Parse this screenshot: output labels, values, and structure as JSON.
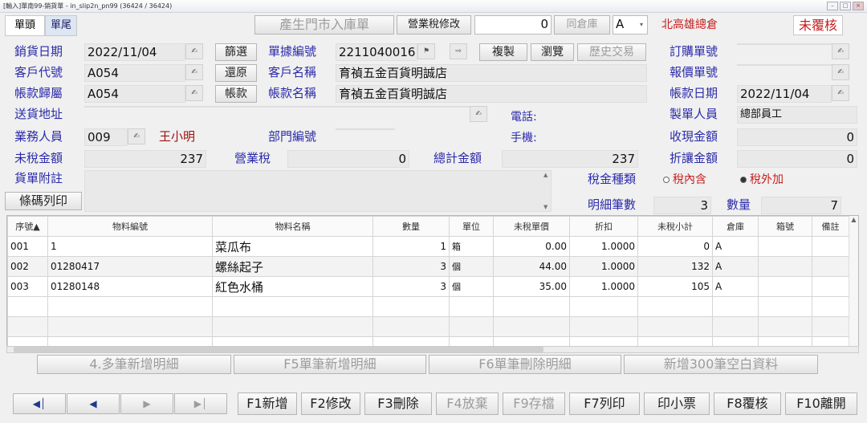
{
  "window": {
    "title": "[輸入]單南99-銷貨單 - in_slip2n_pn99   (36424 / 36424)"
  },
  "tabs": [
    "單頭",
    "單尾"
  ],
  "toolbar": {
    "import_button": "產生門市入庫單",
    "tax_edit_button": "營業稅修改",
    "counter_value": "0",
    "same_warehouse_button": "同倉庫",
    "warehouse_code": "A",
    "branch": "北高雄總倉",
    "review_status": "未覆核"
  },
  "form": {
    "sales_date": {
      "label": "銷貨日期",
      "value": "2022/11/04"
    },
    "filter_button": "篩選",
    "doc_no": {
      "label": "單據編號",
      "value": "2211040016"
    },
    "copy_button": "複製",
    "browse_button": "瀏覽",
    "history_button": "歷史交易",
    "po_no": {
      "label": "訂購單號",
      "value": ""
    },
    "customer_code": {
      "label": "客戶代號",
      "value": "A054"
    },
    "restore_button": "還原",
    "customer_name": {
      "label": "客戶名稱",
      "value": "育禎五金百貨明誠店"
    },
    "quote_no": {
      "label": "報價單號",
      "value": ""
    },
    "account_belong": {
      "label": "帳款歸屬",
      "value": "A054"
    },
    "account_button": "帳款",
    "account_name": {
      "label": "帳款名稱",
      "value": "育禎五金百貨明誠店"
    },
    "account_date": {
      "label": "帳款日期",
      "value": "2022/11/04"
    },
    "ship_address": {
      "label": "送貨地址",
      "value": ""
    },
    "phone": {
      "label": "電話:",
      "value": ""
    },
    "creator": {
      "label": "製單人員",
      "value": "總部員工"
    },
    "salesperson": {
      "label": "業務人員",
      "code": "009",
      "name": "王小明"
    },
    "department": {
      "label": "部門編號",
      "value": ""
    },
    "mobile": {
      "label": "手機:",
      "value": ""
    },
    "cash_received": {
      "label": "收現金額",
      "value": "0"
    },
    "pretax_amount": {
      "label": "未稅金額",
      "value": "237"
    },
    "sales_tax": {
      "label": "營業稅",
      "value": "0"
    },
    "total_amount": {
      "label": "總計金額",
      "value": "237"
    },
    "discount_amount": {
      "label": "折讓金額",
      "value": "0"
    },
    "remarks": {
      "label": "貨單附註",
      "value": ""
    },
    "tax_type": {
      "label": "稅金種類",
      "option_inclusive": "稅內含",
      "option_exclusive": "稅外加",
      "selected": "稅外加"
    },
    "barcode_print_button": "條碼列印",
    "detail_count": {
      "label": "明細筆數",
      "value": "3"
    },
    "quantity": {
      "label": "數量",
      "value": "7"
    }
  },
  "grid": {
    "columns": [
      "序號▲",
      "物料編號",
      "物料名稱",
      "數量",
      "單位",
      "未稅單價",
      "折扣",
      "未稅小計",
      "倉庫",
      "箱號",
      "備註"
    ],
    "rows": [
      [
        "001",
        "1",
        "菜瓜布",
        "1",
        "箱",
        "0.00",
        "1.0000",
        "0",
        "A",
        "",
        ""
      ],
      [
        "002",
        "01280417",
        "螺絲起子",
        "3",
        "個",
        "44.00",
        "1.0000",
        "132",
        "A",
        "",
        ""
      ],
      [
        "003",
        "01280148",
        "紅色水桶",
        "3",
        "個",
        "35.00",
        "1.0000",
        "105",
        "A",
        "",
        ""
      ]
    ]
  },
  "detail_buttons": [
    "4.多筆新增明細",
    "F5單筆新增明細",
    "F6單筆刪除明細",
    "新增300筆空白資料"
  ],
  "nav_icons": [
    "first-record-icon",
    "prev-record-icon",
    "next-record-icon",
    "last-record-icon"
  ],
  "fkeys": [
    "F1新增",
    "F2修改",
    "F3刪除",
    "F4放棄",
    "F9存檔",
    "F7列印",
    "印小票",
    "F8覆核",
    "F10離開"
  ]
}
